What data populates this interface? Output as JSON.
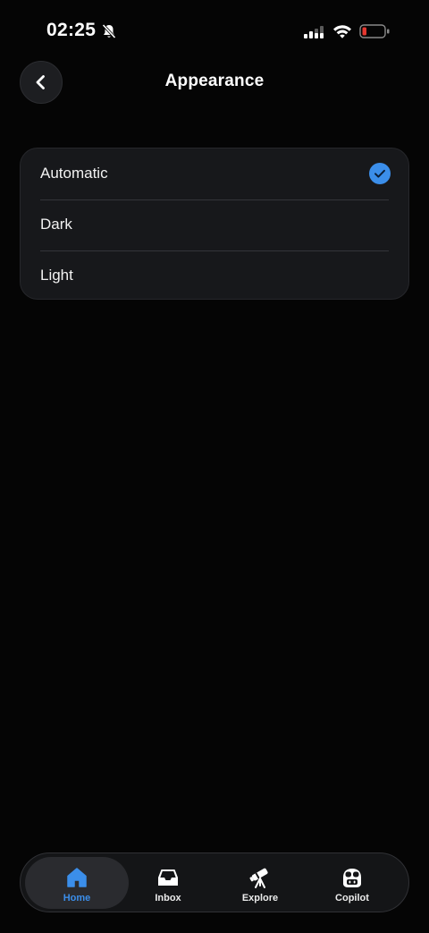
{
  "status_bar": {
    "time": "02:25",
    "icons": [
      "bell-slash-icon",
      "cellular-signal-icon",
      "wifi-icon",
      "battery-low-icon"
    ]
  },
  "header": {
    "title": "Appearance",
    "back_icon": "chevron-left-icon"
  },
  "options": [
    {
      "label": "Automatic",
      "selected": true
    },
    {
      "label": "Dark",
      "selected": false
    },
    {
      "label": "Light",
      "selected": false
    }
  ],
  "tab_bar": {
    "tabs": [
      {
        "label": "Home",
        "icon": "home-icon",
        "active": true
      },
      {
        "label": "Inbox",
        "icon": "inbox-icon",
        "active": false
      },
      {
        "label": "Explore",
        "icon": "telescope-icon",
        "active": false
      },
      {
        "label": "Copilot",
        "icon": "copilot-icon",
        "active": false
      }
    ]
  },
  "colors": {
    "background": "#050505",
    "card": "#17181b",
    "accent": "#3b8eea",
    "battery_low": "#e5372f"
  }
}
